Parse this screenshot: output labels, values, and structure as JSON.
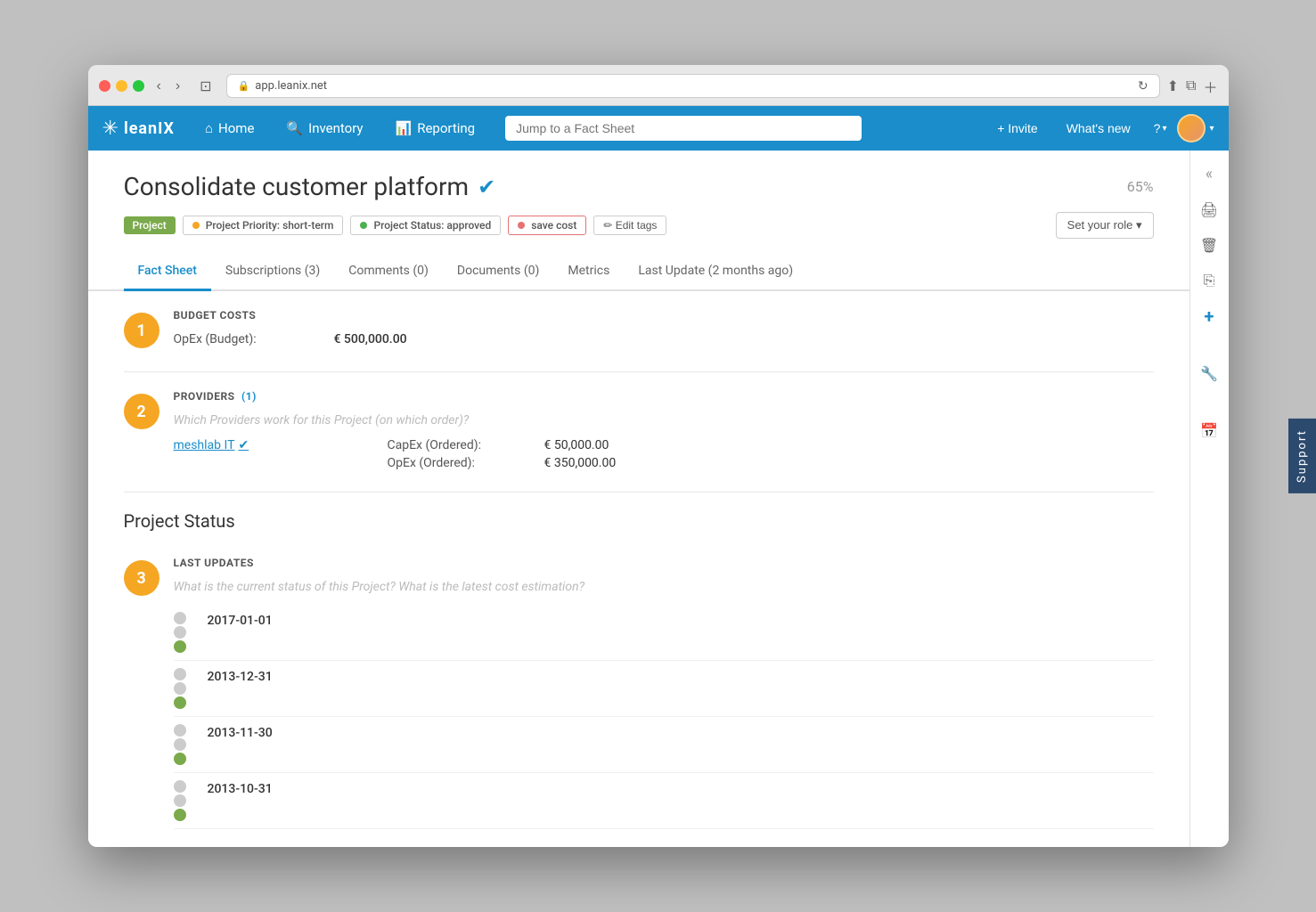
{
  "browser": {
    "url": "app.leanix.net",
    "lock_icon": "🔒"
  },
  "nav": {
    "logo_text": "leanIX",
    "home_label": "Home",
    "inventory_label": "Inventory",
    "reporting_label": "Reporting",
    "jump_placeholder": "Jump to a Fact Sheet",
    "invite_label": "+ Invite",
    "whats_new_label": "What's new",
    "help_label": "?",
    "chevron": "▾"
  },
  "header": {
    "title": "Consolidate customer platform",
    "progress": "65%",
    "tag_project": "Project",
    "tag_priority": "Project Priority: short-term",
    "tag_status": "Project Status: approved",
    "tag_savecost": "save cost",
    "edit_tags_label": "✏ Edit tags",
    "set_role_label": "Set your role ▾"
  },
  "tabs": [
    {
      "id": "fact-sheet",
      "label": "Fact Sheet",
      "active": true
    },
    {
      "id": "subscriptions",
      "label": "Subscriptions (3)",
      "active": false
    },
    {
      "id": "comments",
      "label": "Comments (0)",
      "active": false
    },
    {
      "id": "documents",
      "label": "Documents (0)",
      "active": false
    },
    {
      "id": "metrics",
      "label": "Metrics",
      "active": false
    },
    {
      "id": "last-update",
      "label": "Last Update (2 months ago)",
      "active": false
    }
  ],
  "sections": {
    "budget_costs": {
      "number": "1",
      "title": "BUDGET COSTS",
      "opex_label": "OpEx (Budget):",
      "opex_value": "€ 500,000.00"
    },
    "providers": {
      "number": "2",
      "title": "PROVIDERS",
      "count": "(1)",
      "placeholder": "Which Providers work for this Project (on which order)?",
      "provider_name": "meshlab IT",
      "capex_label": "CapEx (Ordered):",
      "capex_value": "€ 50,000.00",
      "opex_label": "OpEx (Ordered):",
      "opex_value": "€ 350,000.00"
    },
    "project_status": {
      "heading": "Project Status",
      "number": "3",
      "title": "LAST UPDATES",
      "placeholder": "What is the current status of this Project? What is the latest cost estimation?",
      "updates": [
        {
          "date": "2017-01-01",
          "status": "green"
        },
        {
          "date": "2013-12-31",
          "status": "green"
        },
        {
          "date": "2013-11-30",
          "status": "green"
        },
        {
          "date": "2013-10-31",
          "status": "green"
        }
      ]
    }
  },
  "sidebar_icons": {
    "collapse": "«",
    "print": "🖨",
    "trash": "🗑",
    "copy": "⎘",
    "add": "+",
    "wrench": "🔧",
    "calendar": "📅"
  },
  "support_label": "Support"
}
